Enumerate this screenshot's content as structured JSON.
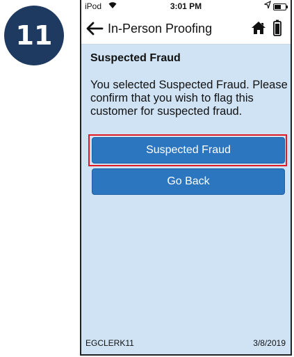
{
  "step": {
    "number": "11"
  },
  "status_bar": {
    "carrier": "iPod",
    "time": "3:01 PM"
  },
  "nav": {
    "title": "In-Person Proofing"
  },
  "screen": {
    "section_title": "Suspected Fraud",
    "message": "You selected Suspected Fraud. Please confirm that you wish to flag this customer for suspected fraud.",
    "primary_button": "Suspected Fraud",
    "secondary_button": "Go Back"
  },
  "footer": {
    "user": "EGCLERK11",
    "date": "3/8/2019"
  },
  "colors": {
    "badge": "#1f3a60",
    "background": "#cfe3f5",
    "button": "#2c76c0",
    "highlight": "#e01b24"
  },
  "icons": {
    "wifi": "wifi-icon",
    "location": "location-arrow-icon",
    "status_battery": "battery-status-icon",
    "back": "back-arrow-icon",
    "home": "home-icon",
    "battery": "battery-icon"
  }
}
